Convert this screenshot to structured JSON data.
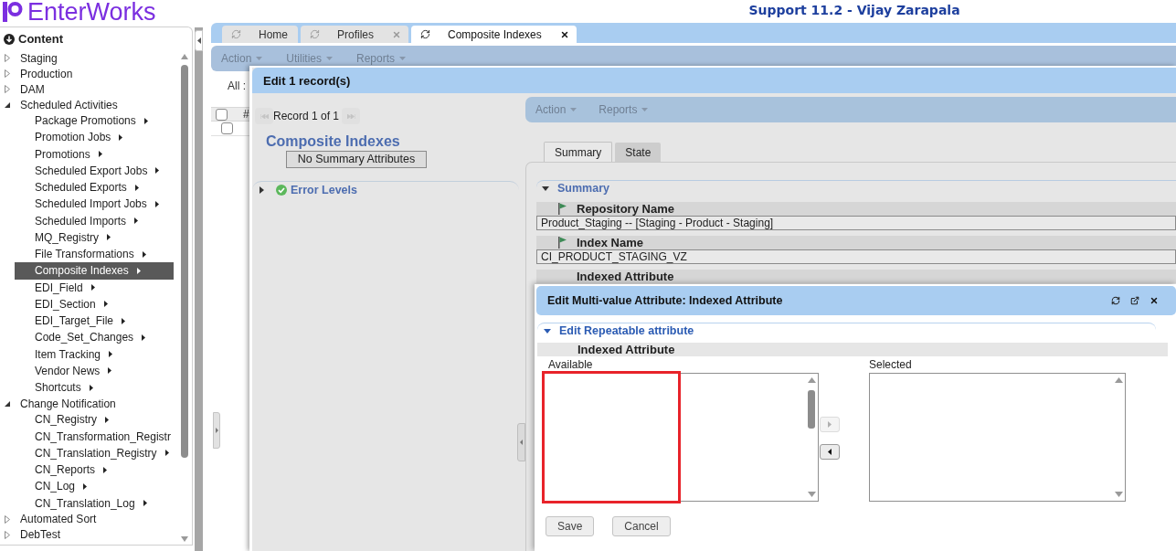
{
  "header": {
    "logo": "EnterWorks",
    "title": "Support 11.2 - Vijay Zarapala"
  },
  "sidebar": {
    "heading": "Content",
    "items": [
      {
        "label": "Staging",
        "expanded": false,
        "selected": false
      },
      {
        "label": "Production",
        "expanded": false,
        "selected": false
      },
      {
        "label": "DAM",
        "expanded": false,
        "selected": false
      },
      {
        "label": "Scheduled Activities",
        "expanded": true,
        "selected": false,
        "children": [
          {
            "label": "Package Promotions",
            "selected": false,
            "arrow": true
          },
          {
            "label": "Promotion Jobs",
            "selected": false,
            "arrow": true
          },
          {
            "label": "Promotions",
            "selected": false,
            "arrow": true
          },
          {
            "label": "Scheduled Export Jobs",
            "selected": false,
            "arrow": true
          },
          {
            "label": "Scheduled Exports",
            "selected": false,
            "arrow": true
          },
          {
            "label": "Scheduled Import Jobs",
            "selected": false,
            "arrow": true
          },
          {
            "label": "Scheduled Imports",
            "selected": false,
            "arrow": true
          },
          {
            "label": "MQ_Registry",
            "selected": false,
            "arrow": true
          },
          {
            "label": "File Transformations",
            "selected": false,
            "arrow": true
          },
          {
            "label": "Composite Indexes",
            "selected": true,
            "arrow": true
          },
          {
            "label": "EDI_Field",
            "selected": false,
            "arrow": true
          },
          {
            "label": "EDI_Section",
            "selected": false,
            "arrow": true
          },
          {
            "label": "EDI_Target_File",
            "selected": false,
            "arrow": true
          },
          {
            "label": "Code_Set_Changes",
            "selected": false,
            "arrow": true
          },
          {
            "label": "Item Tracking",
            "selected": false,
            "arrow": true
          },
          {
            "label": "Vendor News",
            "selected": false,
            "arrow": true
          },
          {
            "label": "Shortcuts",
            "selected": false,
            "arrow": true
          }
        ]
      },
      {
        "label": "Change Notification",
        "expanded": true,
        "selected": false,
        "children": [
          {
            "label": "CN_Registry",
            "selected": false,
            "arrow": true
          },
          {
            "label": "CN_Transformation_Registr",
            "selected": false,
            "arrow": false
          },
          {
            "label": "CN_Translation_Registry",
            "selected": false,
            "arrow": true
          },
          {
            "label": "CN_Reports",
            "selected": false,
            "arrow": true
          },
          {
            "label": "CN_Log",
            "selected": false,
            "arrow": true
          },
          {
            "label": "CN_Translation_Log",
            "selected": false,
            "arrow": true
          }
        ]
      },
      {
        "label": "Automated Sort",
        "expanded": false,
        "selected": false
      },
      {
        "label": "DebTest",
        "expanded": false,
        "selected": false
      }
    ]
  },
  "tabs": [
    {
      "label": "Home",
      "selected": false,
      "closable": false
    },
    {
      "label": "Profiles",
      "selected": false,
      "closable": true
    },
    {
      "label": "Composite Indexes",
      "selected": true,
      "closable": true
    }
  ],
  "toolbar": {
    "menus": [
      "Action",
      "Utilities",
      "Reports"
    ]
  },
  "filter_label": "All :",
  "grid": {
    "columns": [
      "#"
    ],
    "header_checked": false,
    "rows": [
      {
        "checked": false
      }
    ]
  },
  "edit_dialog": {
    "title": "Edit 1 record(s)",
    "record_nav": {
      "label": "Record 1 of 1",
      "first_disabled": true,
      "last_disabled": true
    },
    "heading": "Composite Indexes",
    "summary_button": "No Summary Attributes",
    "sections": [
      {
        "label": "Error Levels",
        "expanded": false,
        "valid": true
      }
    ],
    "menus": [
      "Action",
      "Reports"
    ],
    "tabs": [
      {
        "label": "Summary",
        "selected": true
      },
      {
        "label": "State",
        "selected": false
      }
    ],
    "summary": {
      "label": "Summary",
      "expanded": true,
      "fields": [
        {
          "label": "Repository Name",
          "flagged": true,
          "value": "Product_Staging -- [Staging - Product - Staging]"
        },
        {
          "label": "Index Name",
          "flagged": true,
          "value": "CI_PRODUCT_STAGING_VZ"
        },
        {
          "label": "Indexed Attribute",
          "flagged": false
        }
      ]
    }
  },
  "multi_value_dialog": {
    "title": "Edit Multi-value Attribute: Indexed Attribute",
    "section": {
      "label": "Edit Repeatable attribute",
      "expanded": true
    },
    "attribute_label": "Indexed Attribute",
    "lists": [
      {
        "label": "Available"
      },
      {
        "label": "Selected"
      }
    ],
    "move_buttons": [
      {
        "kind": "add",
        "disabled": true
      },
      {
        "kind": "remove",
        "disabled": false
      }
    ],
    "annotation": {
      "kind": "highlight_box"
    },
    "buttons": [
      "Save",
      "Cancel"
    ]
  }
}
